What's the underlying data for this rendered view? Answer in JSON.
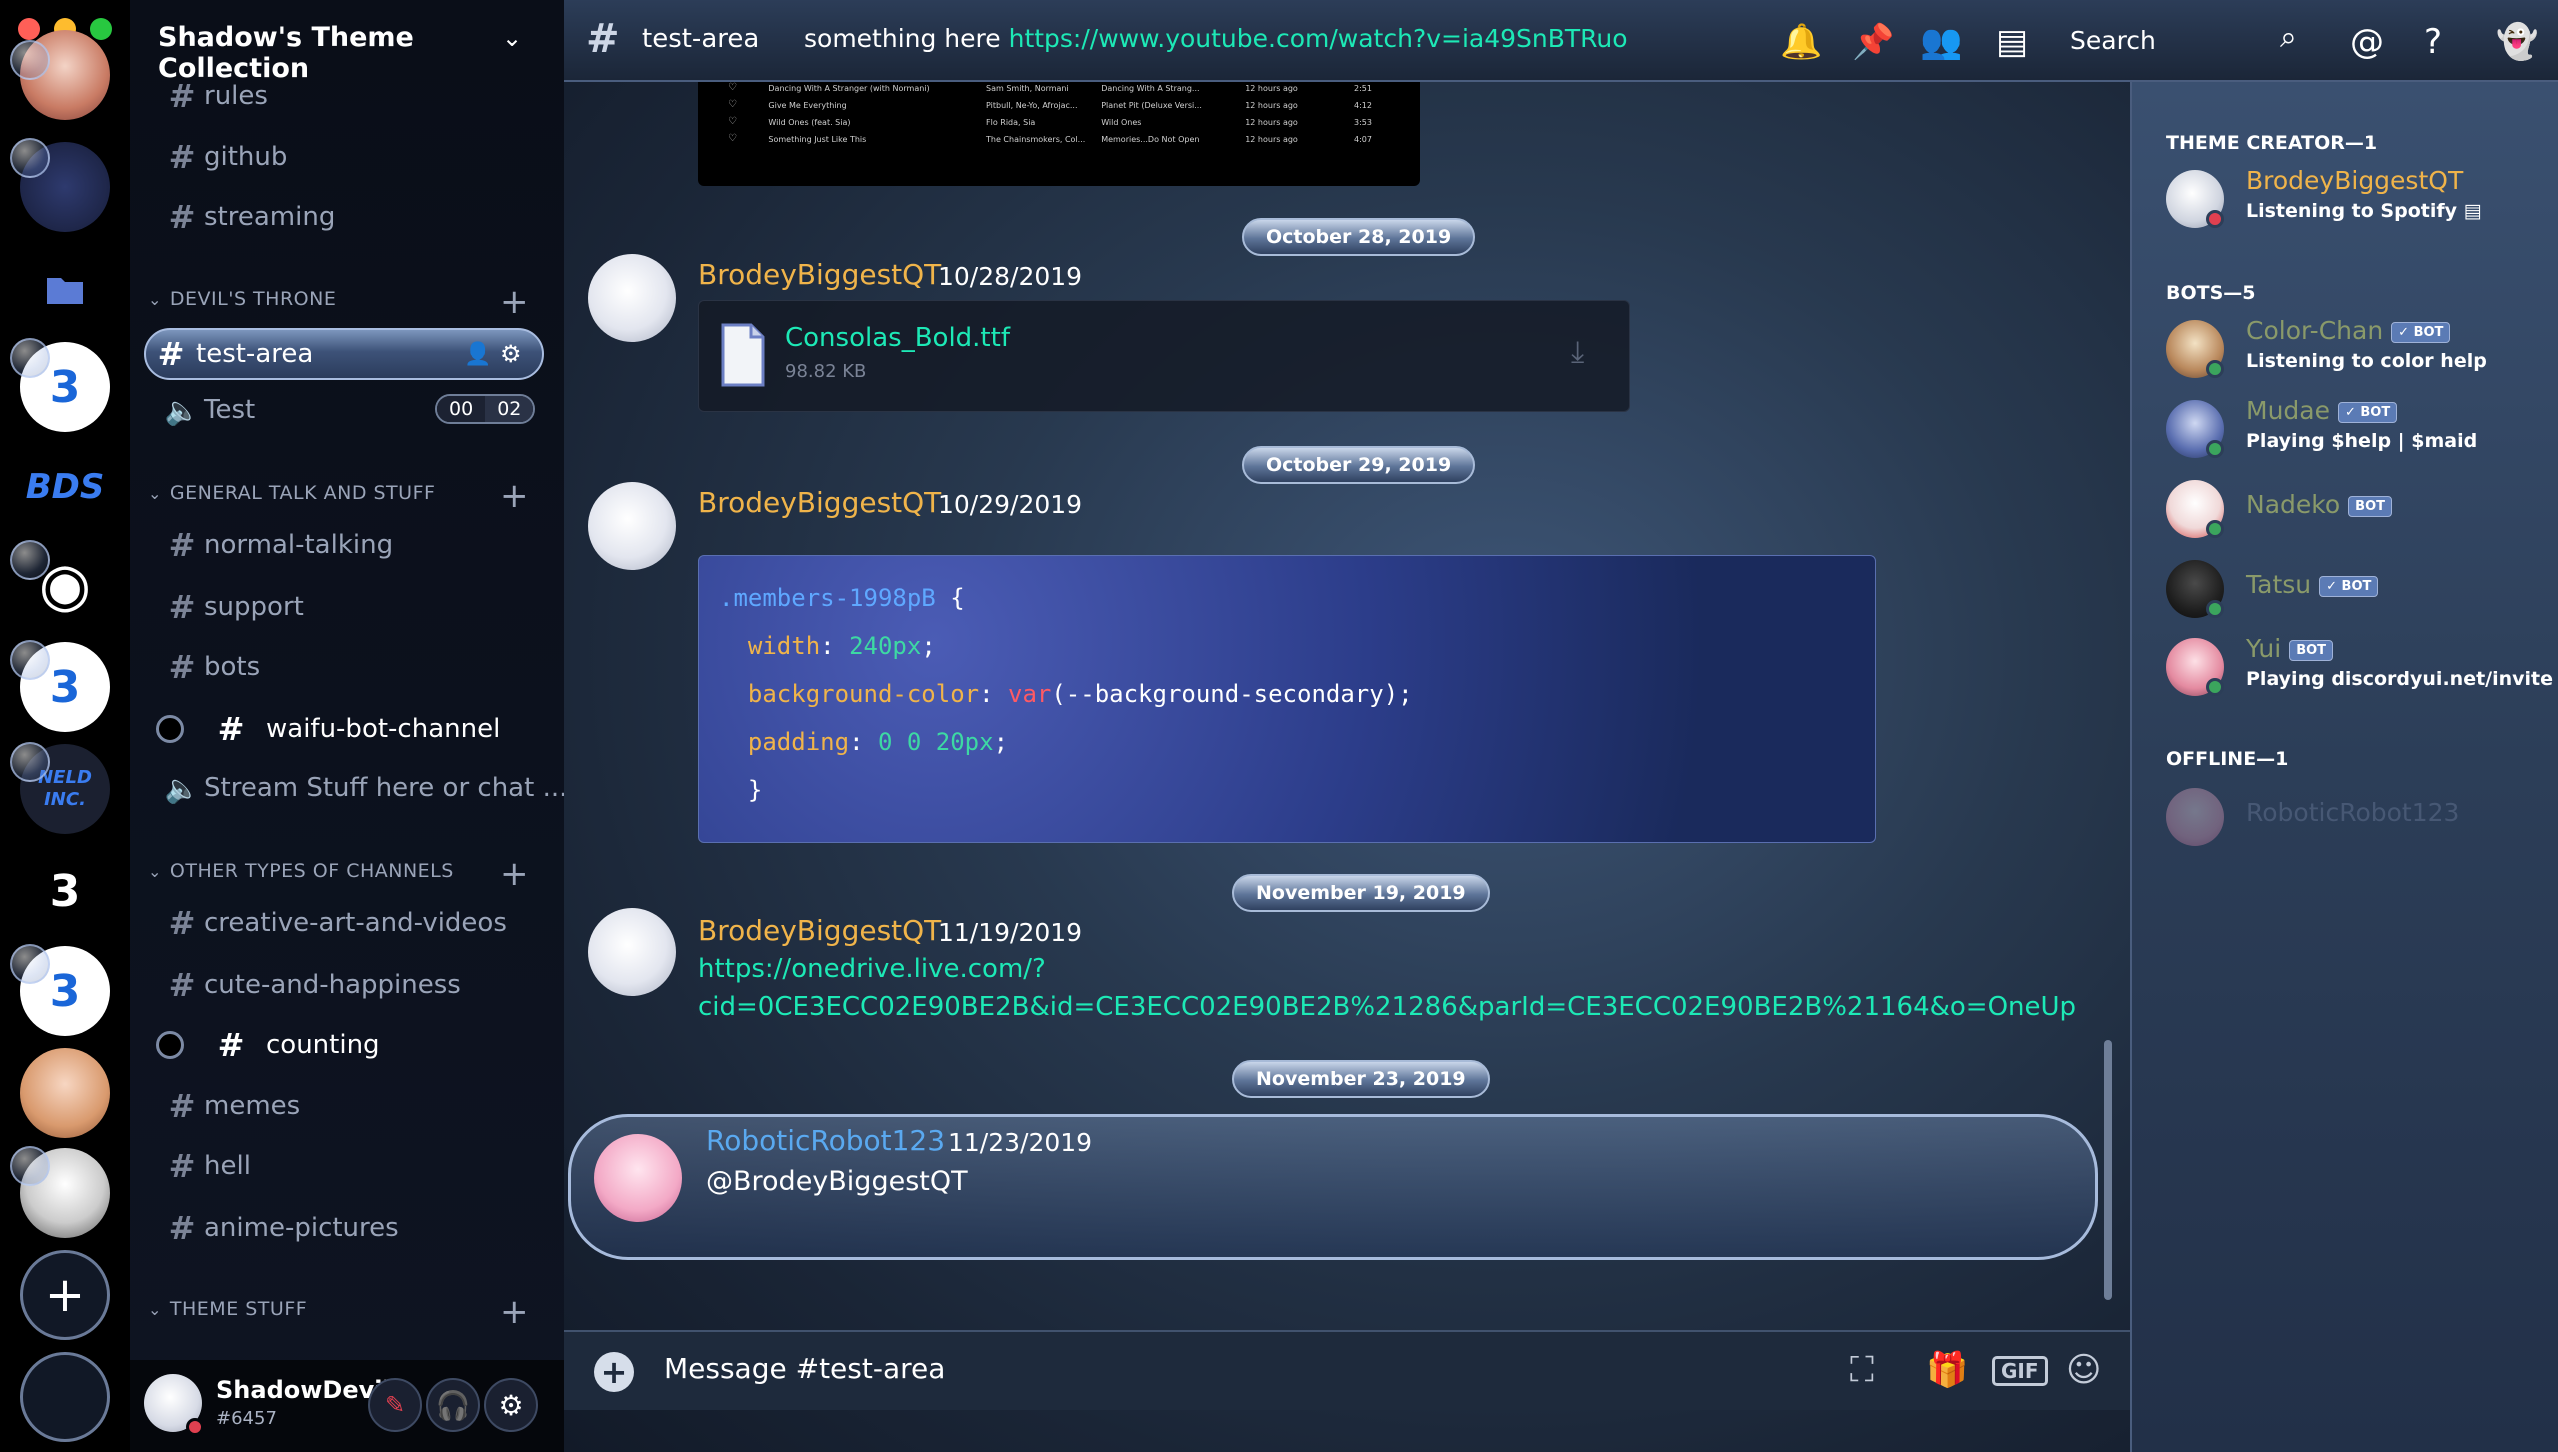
{
  "server": {
    "name": "Shadow's Theme Collection",
    "categories": [
      {
        "label": "DEVIL'S THRONE"
      },
      {
        "label": "GENERAL TALK AND STUFF"
      },
      {
        "label": "OTHER TYPES OF CHANNELS"
      },
      {
        "label": "THEME STUFF"
      }
    ],
    "channels": {
      "rules": "rules",
      "github": "github",
      "streaming": "streaming",
      "test_area": "test-area",
      "test_voice": "Test",
      "normal_talking": "normal-talking",
      "support": "support",
      "bots": "bots",
      "waifu": "waifu-bot-channel",
      "stream_voice": "Stream Stuff here or chat ...",
      "creative": "creative-art-and-videos",
      "cute": "cute-and-happiness",
      "counting": "counting",
      "memes": "memes",
      "hell": "hell",
      "anime": "anime-pictures"
    },
    "voice_count": [
      "00",
      "02"
    ]
  },
  "guild_labels": {
    "bds": "BDS",
    "b3": "3",
    "neld": "NELD INC."
  },
  "user": {
    "name": "ShadowDevil...",
    "tag": "#6457"
  },
  "topbar": {
    "channel": "test-area",
    "topic_text": "something here ",
    "topic_link": "https://www.youtube.com/watch?v=ia49SnBTRuo",
    "search_placeholder": "Search"
  },
  "messages": [
    {
      "date": "October 28, 2019",
      "author": "BrodeyBiggestQT",
      "timestamp": "10/28/2019",
      "file_name": "Consolas_Bold.ttf",
      "file_size": "98.82 KB"
    },
    {
      "date": "October 29, 2019",
      "author": "BrodeyBiggestQT",
      "timestamp": "10/29/2019",
      "code": {
        "selector": ".members-1998pB",
        "open": " {",
        "p1": "width",
        "v1": "240px",
        "p2": "background-color",
        "fn": "var",
        "v2": "(--background-secondary);",
        "p3": "padding",
        "v3": "0 0 20px",
        "close": "}"
      }
    },
    {
      "date": "November 19, 2019",
      "author": "BrodeyBiggestQT",
      "timestamp": "11/19/2019",
      "link1": "https://onedrive.live.com/?",
      "link2": "cid=0CE3ECC02E90BE2B&id=CE3ECC02E90BE2B%21286&parId=CE3ECC02E90BE2B%21164&o=OneUp"
    },
    {
      "date": "November 23, 2019",
      "author": "RoboticRobot123",
      "timestamp": "11/23/2019",
      "content": "@BrodeyBiggestQT"
    }
  ],
  "playlist": [
    {
      "title": "Dancing With A Stranger (with Normani)",
      "artist": "Sam Smith, Normani",
      "album": "Dancing With A Strang...",
      "added": "12 hours ago",
      "time": "2:51"
    },
    {
      "title": "Give Me Everything",
      "artist": "Pitbull, Ne-Yo, Afrojac...",
      "album": "Planet Pit (Deluxe Versi...",
      "added": "12 hours ago",
      "time": "4:12"
    },
    {
      "title": "Wild Ones (feat. Sia)",
      "artist": "Flo Rida, Sia",
      "album": "Wild Ones",
      "added": "12 hours ago",
      "time": "3:53"
    },
    {
      "title": "Something Just Like This",
      "artist": "The Chainsmokers, Col...",
      "album": "Memories...Do Not Open",
      "added": "12 hours ago",
      "time": "4:07"
    }
  ],
  "composer": {
    "placeholder": "Message #test-area",
    "gif": "GIF"
  },
  "members": {
    "theme_creator_header": "THEME CREATOR—1",
    "bots_header": "BOTS—5",
    "offline_header": "OFFLINE—1",
    "bot_tag": "BOT",
    "verified_bot_tag": "✓ BOT",
    "list": [
      {
        "name": "BrodeyBiggestQT",
        "activity": "Listening to Spotify",
        "color": "#f0b44a"
      },
      {
        "name": "Color-Chan",
        "activity": "Listening to color help",
        "color": "#8a9a6a"
      },
      {
        "name": "Mudae",
        "activity": "Playing $help | $maid",
        "color": "#8a9a6a"
      },
      {
        "name": "Nadeko",
        "activity": "",
        "color": "#8a9a6a"
      },
      {
        "name": "Tatsu",
        "activity": "",
        "color": "#8a9a6a"
      },
      {
        "name": "Yui",
        "activity": "Playing discordyui.net/invite",
        "color": "#8a9a6a"
      },
      {
        "name": "RoboticRobot123",
        "activity": "",
        "color": "#5a6a88"
      }
    ]
  },
  "colors": {
    "accent_link": "#1de9b6",
    "author": "#f0b44a",
    "robot_author": "#5aa9f0"
  }
}
